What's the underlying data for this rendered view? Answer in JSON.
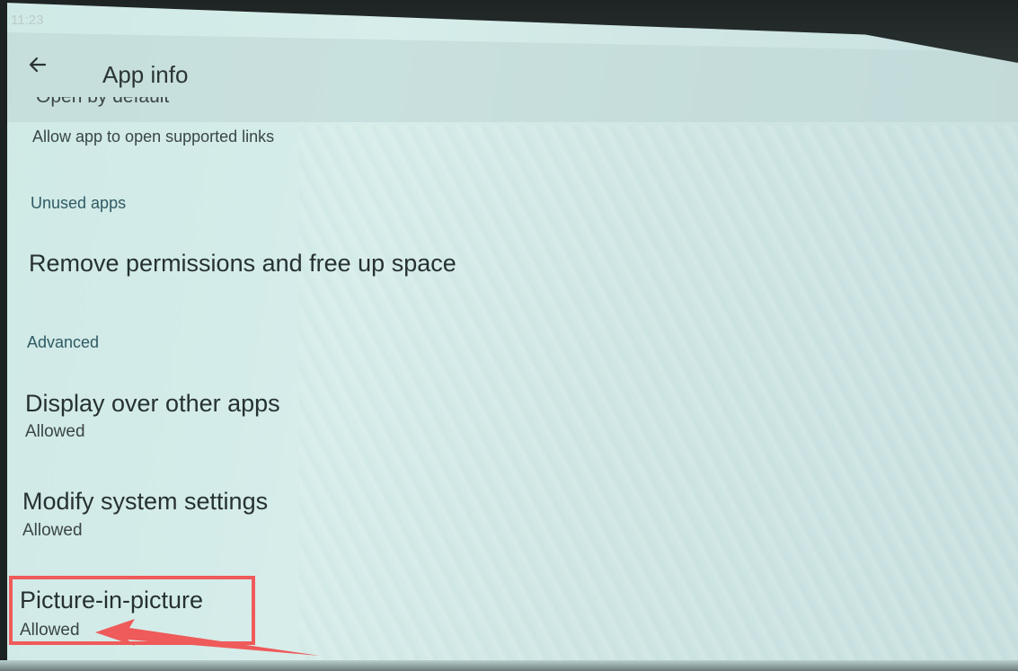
{
  "status_bar": {
    "time": "11:23"
  },
  "app_bar": {
    "back_icon": "arrow-left-icon",
    "title": "App info"
  },
  "open_by_default": {
    "title_cut": "Open by default",
    "subtitle": "Allow app to open supported links"
  },
  "unused_apps": {
    "section_label": "Unused apps",
    "row_title": "Remove permissions and free up space"
  },
  "advanced": {
    "section_label": "Advanced",
    "items": [
      {
        "title": "Display over other apps",
        "status": "Allowed"
      },
      {
        "title": "Modify system settings",
        "status": "Allowed"
      },
      {
        "title": "Picture-in-picture",
        "status": "Allowed"
      }
    ]
  },
  "annotation": {
    "highlight_color": "#ef5a5a"
  }
}
